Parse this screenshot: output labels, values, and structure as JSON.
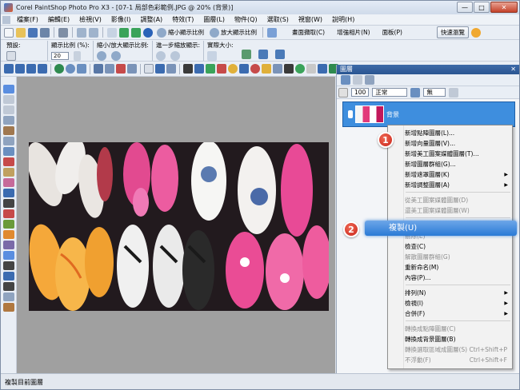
{
  "window": {
    "title": "Corel PaintShop Photo Pro X3 - [07-1 局部色彩範例.JPG @  20% (背景)]",
    "buttons": {
      "minimize": "—",
      "maximize": "□",
      "close": "✕"
    }
  },
  "menu": [
    "檔案(F)",
    "編輯(E)",
    "檢視(V)",
    "影像(I)",
    "調整(A)",
    "特效(T)",
    "圖層(L)",
    "物件(Q)",
    "選取(S)",
    "視窗(W)",
    "說明(H)"
  ],
  "toolbar": {
    "zoom_out_label": "縮小顯示比例",
    "zoom_in_label": "放大顯示比例",
    "screenshot_label": "畫面擷取(C)",
    "enhance_label": "增強相片(N)",
    "panel_label": "面板(P)",
    "workspace_button": "快速瀏覽",
    "preset_label": "預設:"
  },
  "zoombar": {
    "zoom_pct_label": "顯示比例 (%):",
    "zoom_value": "20",
    "zoom_inout_label": "縮小/放大顯示比例:",
    "step_label": "進一步縮放顯示:",
    "actual_size_label": "實際大小:"
  },
  "layers": {
    "title": "圖層",
    "opacity": "100",
    "blend": "正常",
    "lock": "無",
    "layer_name": "背景"
  },
  "context_menu": [
    {
      "label": "新增點陣圖層(L)...",
      "disabled": false,
      "arrow": false,
      "sc": ""
    },
    {
      "label": "新增向量圖層(V)...",
      "disabled": false,
      "arrow": false,
      "sc": ""
    },
    {
      "label": "新增美工圖案媒體圖層(T)...",
      "disabled": false,
      "arrow": false,
      "sc": ""
    },
    {
      "label": "新增圖層群組(G)...",
      "disabled": false,
      "arrow": false,
      "sc": ""
    },
    {
      "label": "新增遮罩圖層(K)",
      "disabled": false,
      "arrow": true,
      "sc": ""
    },
    {
      "label": "新增調整圖層(A)",
      "disabled": false,
      "arrow": true,
      "sc": ""
    },
    {
      "sep": true
    },
    {
      "label": "從美工圖案媒體圖層(D)",
      "disabled": true,
      "arrow": false,
      "sc": ""
    },
    {
      "label": "還美工圖案媒體圖層(W)",
      "disabled": true,
      "arrow": false,
      "sc": ""
    },
    {
      "sep": true
    },
    {
      "label": "複製(U)",
      "disabled": false,
      "arrow": false,
      "sc": "",
      "hidden": true
    },
    {
      "label": "刪除(E)",
      "disabled": true,
      "arrow": false,
      "sc": ""
    },
    {
      "label": "檢查(C)",
      "disabled": false,
      "arrow": false,
      "sc": ""
    },
    {
      "label": "解散圖層群組(G)",
      "disabled": true,
      "arrow": false,
      "sc": ""
    },
    {
      "label": "重新命名(M)",
      "disabled": false,
      "arrow": false,
      "sc": ""
    },
    {
      "label": "內容(P)...",
      "disabled": false,
      "arrow": false,
      "sc": ""
    },
    {
      "sep": true
    },
    {
      "label": "排列(N)",
      "disabled": false,
      "arrow": true,
      "sc": ""
    },
    {
      "label": "檢視(I)",
      "disabled": false,
      "arrow": true,
      "sc": ""
    },
    {
      "label": "合併(F)",
      "disabled": false,
      "arrow": true,
      "sc": ""
    },
    {
      "sep": true
    },
    {
      "label": "轉換成點陣圖層(C)",
      "disabled": true,
      "arrow": false,
      "sc": ""
    },
    {
      "label": "轉換成背景圖層(B)",
      "disabled": false,
      "arrow": false,
      "sc": ""
    },
    {
      "label": "轉換選取區域成圖層(S)",
      "disabled": true,
      "arrow": false,
      "sc": "Ctrl+Shift+P"
    },
    {
      "label": "不浮動(F)",
      "disabled": true,
      "arrow": false,
      "sc": "Ctrl+Shift+F"
    }
  ],
  "highlight": {
    "copy_label": "複製(U)",
    "step1": "1",
    "step2": "2"
  },
  "status": {
    "text": "複製目前圖層"
  }
}
